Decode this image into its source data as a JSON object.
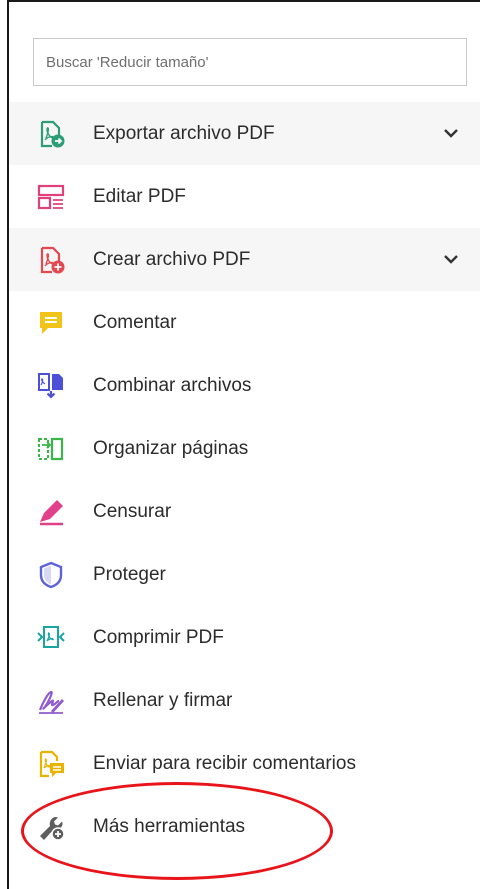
{
  "search": {
    "placeholder": "Buscar 'Reducir tamaño'"
  },
  "tools": [
    {
      "name": "exportar",
      "label": "Exportar archivo PDF",
      "icon": "export-pdf-icon",
      "color": "#2d9d78",
      "expandable": true
    },
    {
      "name": "editar",
      "label": "Editar PDF",
      "icon": "edit-pdf-icon",
      "color": "#e0417a",
      "expandable": false
    },
    {
      "name": "crear",
      "label": "Crear archivo PDF",
      "icon": "create-pdf-icon",
      "color": "#e34850",
      "expandable": true
    },
    {
      "name": "comentar",
      "label": "Comentar",
      "icon": "comment-icon",
      "color": "#f2c319",
      "expandable": false
    },
    {
      "name": "combinar",
      "label": "Combinar archivos",
      "icon": "combine-files-icon",
      "color": "#4b50d6",
      "expandable": false
    },
    {
      "name": "organizar",
      "label": "Organizar páginas",
      "icon": "organize-pages-icon",
      "color": "#39b54a",
      "expandable": false
    },
    {
      "name": "censurar",
      "label": "Censurar",
      "icon": "redact-icon",
      "color": "#e0418a",
      "expandable": false
    },
    {
      "name": "proteger",
      "label": "Proteger",
      "icon": "shield-icon",
      "color": "#5c63d8",
      "expandable": false
    },
    {
      "name": "comprimir",
      "label": "Comprimir PDF",
      "icon": "compress-pdf-icon",
      "color": "#1aa3a3",
      "expandable": false
    },
    {
      "name": "rellenar",
      "label": "Rellenar y firmar",
      "icon": "fill-sign-icon",
      "color": "#8e5ccf",
      "expandable": false
    },
    {
      "name": "enviar",
      "label": "Enviar para recibir comentarios",
      "icon": "send-for-comments-icon",
      "color": "#e8b400",
      "expandable": false
    },
    {
      "name": "mas",
      "label": "Más herramientas",
      "icon": "more-tools-icon",
      "color": "#5e5e5e",
      "expandable": false
    }
  ],
  "annotation": {
    "color": "#e8141a"
  }
}
